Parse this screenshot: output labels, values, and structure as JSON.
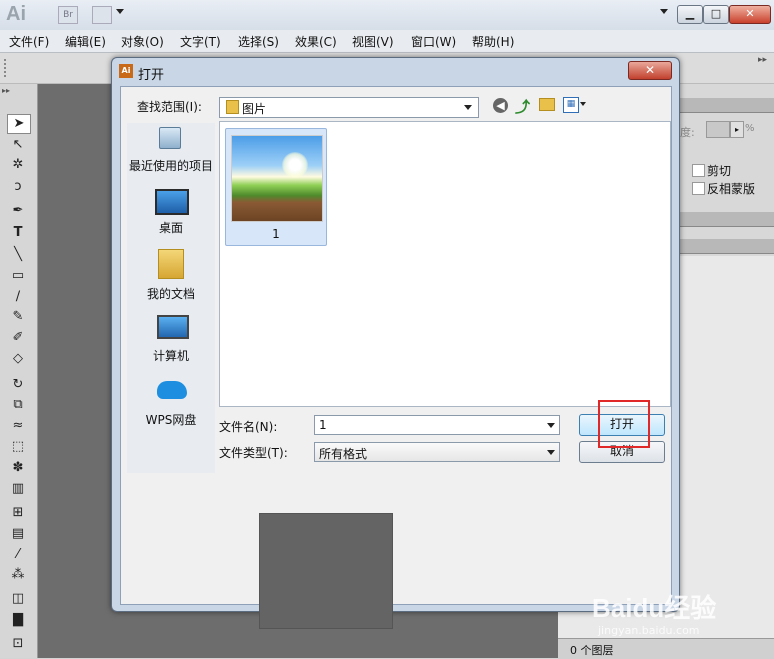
{
  "app": {
    "logo_text": "Ai",
    "bridge_label": "Br",
    "menu": [
      "文件(F)",
      "编辑(E)",
      "对象(O)",
      "文字(T)",
      "选择(S)",
      "效果(C)",
      "视图(V)",
      "窗口(W)",
      "帮助(H)"
    ],
    "window_buttons": {
      "minimize": "▁",
      "maximize": "□",
      "close": "✕"
    }
  },
  "toolbox": {
    "tools": [
      "selection",
      "direct-selection",
      "magic-wand",
      "lasso",
      "pen",
      "type",
      "line",
      "rectangle",
      "paintbrush",
      "pencil",
      "blob-brush",
      "eraser",
      "rotate",
      "scale",
      "warp",
      "free-transform",
      "symbol-sprayer",
      "column-graph",
      "mesh",
      "gradient",
      "eyedropper",
      "blend",
      "live-paint",
      "crop",
      "slice"
    ],
    "type_glyph": "T"
  },
  "right_panel": {
    "checkbox_clip": "剪切",
    "checkbox_invert_mask": "反相蒙版",
    "opacity_label": "度:",
    "percent_sign": "%",
    "layers_count": "0 个图层"
  },
  "dialog": {
    "title": "打开",
    "app_badge": "Ai",
    "close_glyph": "✕",
    "look_in_label": "查找范围(I):",
    "look_in_value": "图片",
    "places": [
      {
        "icon": "recent-items-icon",
        "label": "最近使用的项目"
      },
      {
        "icon": "desktop-icon",
        "label": "桌面"
      },
      {
        "icon": "my-documents-icon",
        "label": "我的文档"
      },
      {
        "icon": "computer-icon",
        "label": "计算机"
      },
      {
        "icon": "wps-cloud-icon",
        "label": "WPS网盘"
      }
    ],
    "files": [
      {
        "name": "1",
        "selected": true
      }
    ],
    "file_name_label": "文件名(N):",
    "file_name_value": "1",
    "file_type_label": "文件类型(T):",
    "file_type_value": "所有格式",
    "open_button": "打开",
    "cancel_button": "取消"
  },
  "watermark": {
    "brand": "Baidu经验",
    "url": "jingyan.baidu.com"
  },
  "colors": {
    "highlight": "#e02828",
    "dialog_frame": "#c9d6e6",
    "canvas": "#6d6d6d"
  }
}
